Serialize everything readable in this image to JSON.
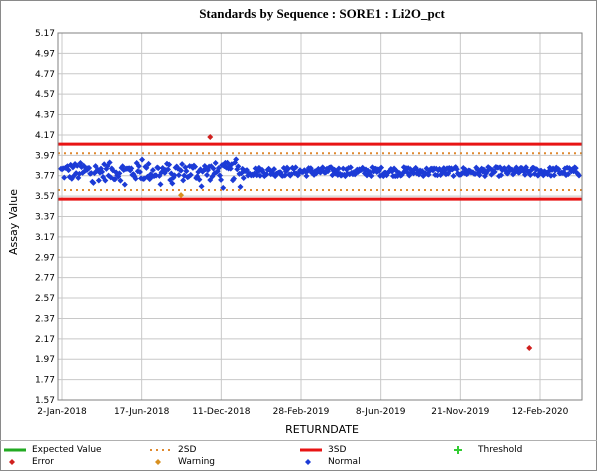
{
  "chart_data": {
    "type": "scatter",
    "title": "Standards by Sequence : SORE1 : Li2O_pct",
    "xlabel": "RETURNDATE",
    "ylabel": "Assay Value",
    "x_tick_labels": [
      "2-Jan-2018",
      "17-Jun-2018",
      "11-Dec-2018",
      "28-Feb-2019",
      "8-Jun-2019",
      "21-Nov-2019",
      "12-Feb-2020"
    ],
    "y_ticks": [
      1.57,
      1.77,
      1.97,
      2.17,
      2.37,
      2.57,
      2.77,
      2.97,
      3.17,
      3.37,
      3.57,
      3.77,
      3.97,
      4.17,
      4.37,
      4.57,
      4.77,
      4.97,
      5.17
    ],
    "ylim": [
      1.57,
      5.17
    ],
    "n_samples": 480,
    "expected_value": 3.81,
    "two_sd": [
      3.63,
      3.99
    ],
    "three_sd": [
      3.54,
      4.08
    ],
    "normal_range": [
      3.65,
      3.96
    ],
    "error_points": [
      {
        "sequence": 138,
        "value": 4.15
      },
      {
        "sequence": 433,
        "value": 2.08
      }
    ],
    "warning_points": [
      {
        "sequence": 111,
        "value": 3.58
      }
    ],
    "grid": true,
    "legend_position": "bottom",
    "colors": {
      "expected": "#22aa22",
      "two_sd": "#e08a30",
      "three_sd": "#e81414",
      "threshold": "#33cc33",
      "error": "#d0201e",
      "warning": "#d89020",
      "normal": "#1c3bd6",
      "grid": "#c8c8c8"
    },
    "legend": [
      {
        "key": "expected",
        "label": "Expected Value"
      },
      {
        "key": "two_sd",
        "label": "2SD"
      },
      {
        "key": "three_sd",
        "label": "3SD"
      },
      {
        "key": "threshold",
        "label": "Threshold"
      },
      {
        "key": "error",
        "label": "Error"
      },
      {
        "key": "warning",
        "label": "Warning"
      },
      {
        "key": "normal",
        "label": "Normal"
      }
    ]
  }
}
